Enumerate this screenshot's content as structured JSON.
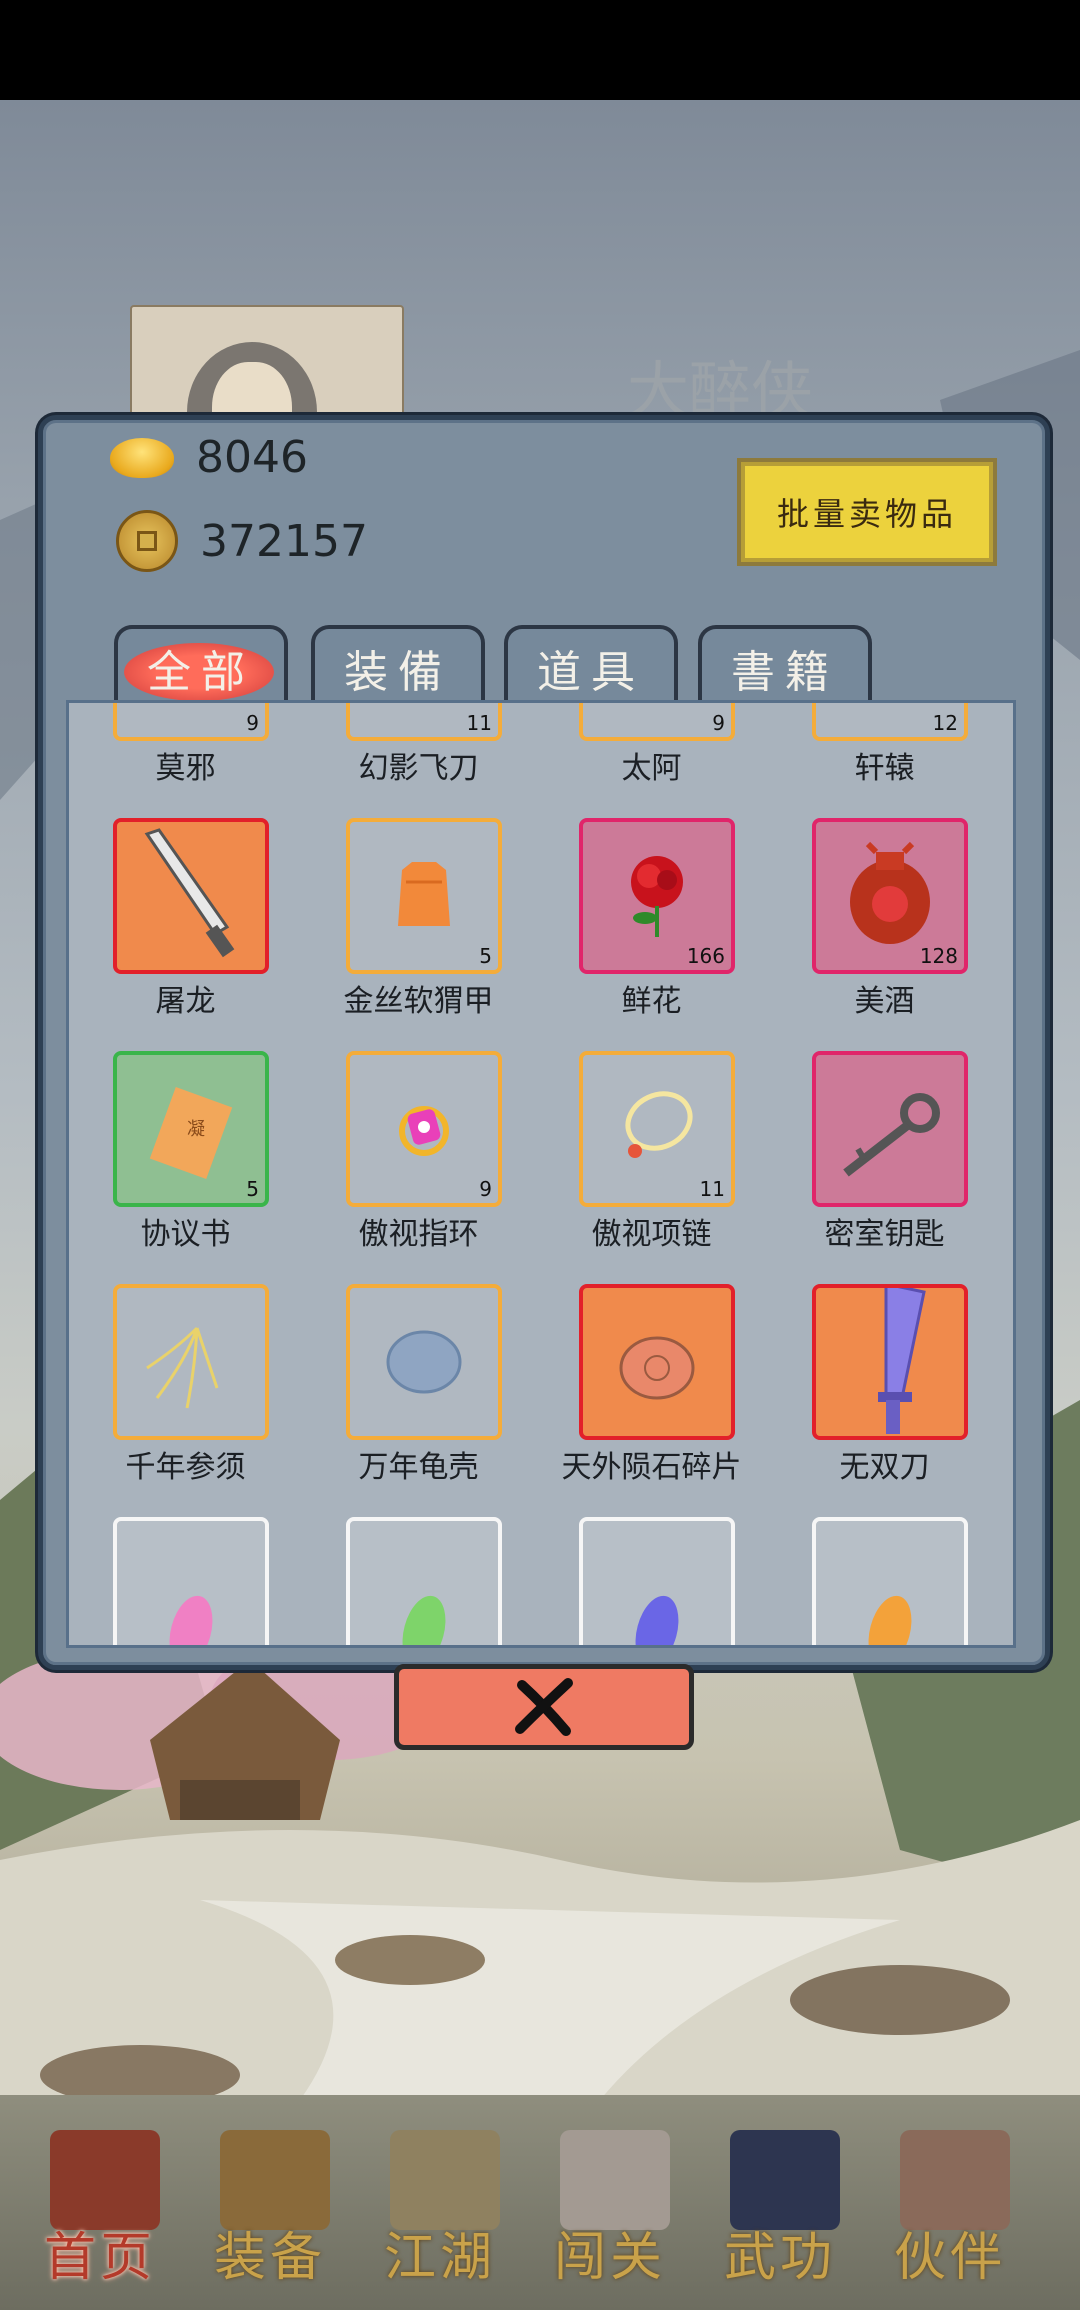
{
  "hero": {
    "name": "大醉侠"
  },
  "currency": {
    "gold_icon": "gold-ingot-icon",
    "gold": "8046",
    "coin_icon": "copper-coin-icon",
    "coins": "372157"
  },
  "sell_button": "批量卖物品",
  "tabs": [
    {
      "label": "全部",
      "active": true
    },
    {
      "label": "装備",
      "active": false
    },
    {
      "label": "道具",
      "active": false
    },
    {
      "label": "書籍",
      "active": false
    }
  ],
  "items": [
    {
      "name": "莫邪",
      "count": "9",
      "rarity": "orange",
      "icon": "sword-icon"
    },
    {
      "name": "幻影飞刀",
      "count": "11",
      "rarity": "orange",
      "icon": "flying-blade-icon"
    },
    {
      "name": "太阿",
      "count": "9",
      "rarity": "orange",
      "icon": "sword-icon"
    },
    {
      "name": "轩辕",
      "count": "12",
      "rarity": "orange",
      "icon": "sword-icon"
    },
    {
      "name": "屠龙",
      "count": "",
      "rarity": "red",
      "icon": "broadsword-icon"
    },
    {
      "name": "金丝软猬甲",
      "count": "5",
      "rarity": "orange",
      "icon": "armor-vest-icon"
    },
    {
      "name": "鲜花",
      "count": "166",
      "rarity": "pink",
      "icon": "rose-icon"
    },
    {
      "name": "美酒",
      "count": "128",
      "rarity": "pink",
      "icon": "wine-jar-icon"
    },
    {
      "name": "协议书",
      "count": "5",
      "rarity": "green",
      "icon": "contract-paper-icon"
    },
    {
      "name": "傲视指环",
      "count": "9",
      "rarity": "orange",
      "icon": "ring-icon"
    },
    {
      "name": "傲视项链",
      "count": "11",
      "rarity": "orange",
      "icon": "necklace-icon"
    },
    {
      "name": "密室钥匙",
      "count": "",
      "rarity": "pink",
      "icon": "key-icon"
    },
    {
      "name": "千年参须",
      "count": "",
      "rarity": "orange",
      "icon": "ginseng-root-icon"
    },
    {
      "name": "万年龟壳",
      "count": "",
      "rarity": "orange",
      "icon": "turtle-shell-icon"
    },
    {
      "name": "天外陨石碎片",
      "count": "",
      "rarity": "red",
      "icon": "meteorite-fragment-icon"
    },
    {
      "name": "无双刀",
      "count": "",
      "rarity": "red",
      "icon": "blade-icon"
    },
    {
      "name": "",
      "count": "",
      "rarity": "white",
      "icon": "pink-feather-icon"
    },
    {
      "name": "",
      "count": "",
      "rarity": "white",
      "icon": "green-feather-icon"
    },
    {
      "name": "",
      "count": "",
      "rarity": "white",
      "icon": "blue-feather-icon"
    },
    {
      "name": "",
      "count": "",
      "rarity": "white",
      "icon": "orange-feather-icon"
    }
  ],
  "close_icon": "close-x-icon",
  "nav": [
    {
      "label": "首页",
      "icon": "home-temple-icon",
      "active": true
    },
    {
      "label": "装备",
      "icon": "armor-icon",
      "active": false
    },
    {
      "label": "江湖",
      "icon": "scroll-map-icon",
      "active": false
    },
    {
      "label": "闯关",
      "icon": "crossed-swords-icon",
      "active": false
    },
    {
      "label": "武功",
      "icon": "martial-book-icon",
      "active": false
    },
    {
      "label": "伙伴",
      "icon": "companions-icon",
      "active": false
    }
  ]
}
